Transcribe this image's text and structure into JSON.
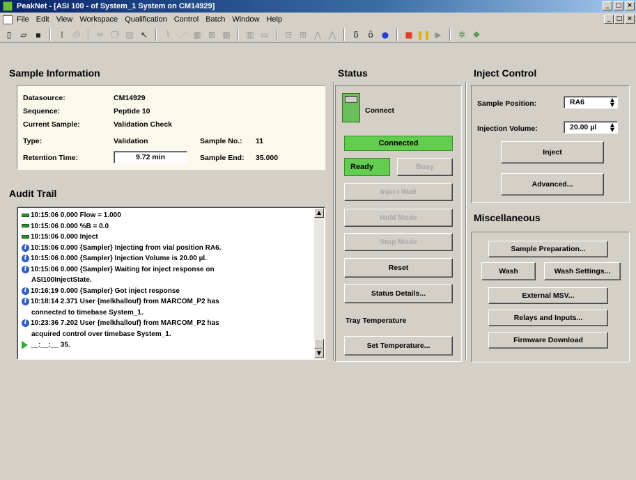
{
  "window": {
    "title": "PeakNet - [ASI 100 - of System_1 System on  CM14929]",
    "controls": [
      "_",
      "□",
      "×"
    ],
    "mdi_controls": [
      "_",
      "□",
      "×"
    ]
  },
  "menu": [
    "File",
    "Edit",
    "View",
    "Workspace",
    "Qualification",
    "Control",
    "Batch",
    "Window",
    "Help"
  ],
  "toolbar": {
    "icons": [
      {
        "name": "new-icon",
        "glyph": "▯",
        "disabled": false
      },
      {
        "name": "open-icon",
        "glyph": "▱",
        "disabled": false
      },
      {
        "name": "save-icon",
        "glyph": "▪",
        "disabled": false
      },
      {
        "name": "sep"
      },
      {
        "name": "sequence-icon",
        "glyph": "⁞",
        "disabled": false
      },
      {
        "name": "print-icon",
        "glyph": "⎙",
        "disabled": true
      },
      {
        "name": "sep"
      },
      {
        "name": "cut-icon",
        "glyph": "✂",
        "disabled": true
      },
      {
        "name": "copy-icon",
        "glyph": "❐",
        "disabled": true
      },
      {
        "name": "paste-icon",
        "glyph": "▤",
        "disabled": true
      },
      {
        "name": "help-pointer-icon",
        "glyph": "↖",
        "disabled": false
      },
      {
        "name": "sep"
      },
      {
        "name": "chart-icon",
        "glyph": "⌇",
        "disabled": true
      },
      {
        "name": "chart2-icon",
        "glyph": "⋰",
        "disabled": true
      },
      {
        "name": "grid-icon",
        "glyph": "▦",
        "disabled": true
      },
      {
        "name": "zoom-icon",
        "glyph": "⊠",
        "disabled": true
      },
      {
        "name": "table-icon",
        "glyph": "▦",
        "disabled": true
      },
      {
        "name": "sep"
      },
      {
        "name": "layout-icon",
        "glyph": "▥",
        "disabled": true
      },
      {
        "name": "window-icon",
        "glyph": "▭",
        "disabled": true
      },
      {
        "name": "sep"
      },
      {
        "name": "align-icon",
        "glyph": "⊟",
        "disabled": true
      },
      {
        "name": "align2-icon",
        "glyph": "⊞",
        "disabled": true
      },
      {
        "name": "peak-icon",
        "glyph": "⋀",
        "disabled": true
      },
      {
        "name": "peak2-icon",
        "glyph": "⋀",
        "disabled": true
      },
      {
        "name": "sep"
      },
      {
        "name": "flask-icon",
        "glyph": "δ",
        "disabled": false
      },
      {
        "name": "vial-icon",
        "glyph": "ō",
        "disabled": false
      },
      {
        "name": "record-icon",
        "glyph": "●",
        "disabled": false,
        "color": "#2040d0"
      },
      {
        "name": "sep"
      },
      {
        "name": "stop-icon",
        "glyph": "■",
        "disabled": false,
        "color": "#e04020"
      },
      {
        "name": "pause-icon",
        "glyph": "❚❚",
        "disabled": false,
        "color": "#e0b000"
      },
      {
        "name": "play-icon",
        "glyph": "▶",
        "disabled": false,
        "color": "#909090"
      },
      {
        "name": "sep"
      },
      {
        "name": "settings-icon",
        "glyph": "✲",
        "disabled": false,
        "color": "#2e8b2e"
      },
      {
        "name": "module-icon",
        "glyph": "❖",
        "disabled": false,
        "color": "#2e8b2e"
      }
    ]
  },
  "sample_info": {
    "title": "Sample Information",
    "datasource_label": "Datasource:",
    "datasource_value": "CM14929",
    "sequence_label": "Sequence:",
    "sequence_value": "Peptide 10",
    "current_sample_label": "Current Sample:",
    "current_sample_value": "Validation Check",
    "type_label": "Type:",
    "type_value": "Validation",
    "sample_no_label": "Sample No.:",
    "sample_no_value": "11",
    "retention_label": "Retention Time:",
    "retention_value": "9.72 min",
    "sample_end_label": "Sample End:",
    "sample_end_value": "35.000"
  },
  "audit_trail": {
    "title": "Audit Trail",
    "lines": [
      {
        "icon": "green",
        "text": "10:15:06 0.000 Flow = 1.000"
      },
      {
        "icon": "green",
        "text": "10:15:06 0.000 %B = 0.0"
      },
      {
        "icon": "green",
        "text": "10:15:06 0.000 Inject"
      },
      {
        "icon": "info",
        "text": "10:15:06 0.000 {Sampler} Injecting from vial position RA6."
      },
      {
        "icon": "info",
        "text": "10:15:06 0.000 {Sampler} Injection Volume is 20.00 µl."
      },
      {
        "icon": "info",
        "text": "10:15:06 0.000 {Sampler} Waiting for inject response on"
      },
      {
        "icon": "none",
        "text": "ASI100InjectState."
      },
      {
        "icon": "info",
        "text": "10:16:19 0.000 {Sampler} Got inject response"
      },
      {
        "icon": "info",
        "text": "10:18:14 2.371 User  {melkhallouf} from MARCOM_P2 has"
      },
      {
        "icon": "none",
        "text": "connected to timebase System_1."
      },
      {
        "icon": "info",
        "text": "10:23:36 7.202 User  {melkhallouf} from MARCOM_P2 has"
      },
      {
        "icon": "none",
        "text": "acquired control over timebase System_1."
      },
      {
        "icon": "arrow",
        "text": "__:__:__ 35."
      }
    ]
  },
  "status": {
    "title": "Status",
    "connect_label": "Connect",
    "connected_label": "Connected",
    "ready_label": "Ready",
    "busy_label": "Busy",
    "inject_wait_label": "Inject Wait",
    "hold_mode_label": "Hold Mode",
    "stop_mode_label": "Stop Mode",
    "reset_label": "Reset",
    "status_details_label": "Status Details...",
    "tray_temp_label": "Tray Temperature",
    "set_temp_label": "Set Temperature..."
  },
  "inject_control": {
    "title": "Inject Control",
    "sample_position_label": "Sample Position:",
    "sample_position_value": "RA6",
    "injection_volume_label": "Injection Volume:",
    "injection_volume_value": "20.00 µl",
    "inject_label": "Inject",
    "advanced_label": "Advanced..."
  },
  "misc": {
    "title": "Miscellaneous",
    "sample_prep_label": "Sample Preparation...",
    "wash_label": "Wash",
    "wash_settings_label": "Wash Settings...",
    "external_msv_label": "External MSV...",
    "relays_label": "Relays and Inputs...",
    "firmware_label": "Firmware Download"
  }
}
